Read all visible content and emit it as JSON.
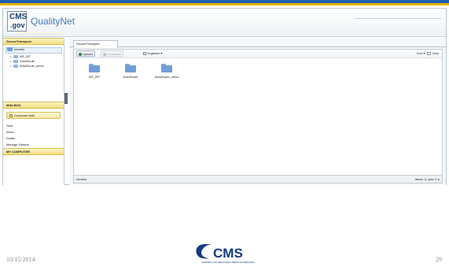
{
  "brand": {
    "logo_top": "CMS",
    "logo_bottom": ".gov",
    "name": "QualityNet"
  },
  "sidebar": {
    "section_secure": "SecureTransport",
    "tree": {
      "root": "mmebs",
      "children": [
        "AR_ZIP",
        "AutoRoute",
        "AutoRoute_inbox"
      ]
    },
    "section_mailbox": "MAILBOX",
    "compose": "Compose Mail",
    "links": [
      "Sent",
      "Inbox",
      "Drafts",
      "Manage Folders"
    ],
    "section_computer": "MY COMPUTER"
  },
  "main": {
    "tab": "SecureTransport",
    "toolbar": {
      "upload": "Upload",
      "download": "Download",
      "organize": "Organize ▾",
      "sort": "Sort ▾",
      "view": "View"
    },
    "files": [
      "AR_ZIP",
      "AutoRoute",
      "AutoRoute_inbox"
    ],
    "status_left": "mmebs",
    "status_right": "Items: 3, size: 0 b"
  },
  "footer": {
    "date": "10/15/2014",
    "page": "29",
    "logo_text": "CMS",
    "logo_subtext": "CENTERS FOR MEDICARE & MEDICAID SERVICES"
  },
  "colors": {
    "top_band_blue": "#1f5fb0",
    "top_band_gold": "#e8b400",
    "section_gold": "#f2dc7b",
    "folder_blue": "#6f9fd7",
    "cms_logo_blue": "#123a80"
  }
}
